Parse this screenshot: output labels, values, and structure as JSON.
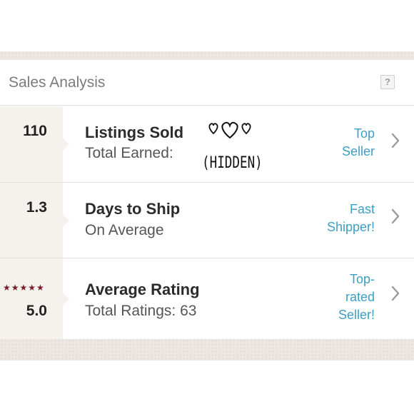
{
  "panel": {
    "title": "Sales Analysis",
    "help_label": "?"
  },
  "rows": [
    {
      "value": "110",
      "label": "Listings Sold",
      "sublabel": "Total Earned:",
      "sublabel_value": "(HIDDEN)",
      "badge": [
        "Top",
        "Seller"
      ]
    },
    {
      "value": "1.3",
      "label": "Days to Ship",
      "sublabel": "On Average",
      "badge": [
        "Fast",
        "Shipper!"
      ]
    },
    {
      "value": "5.0",
      "stars": "★★★★★",
      "label": "Average Rating",
      "sublabel": "Total Ratings: 63",
      "badge": [
        "Top-",
        "rated",
        "Seller!"
      ]
    }
  ],
  "colors": {
    "accent": "#3d9fc3",
    "stars": "#7a1c25",
    "title": "#7b7b7b",
    "left_column": "#f5f2ee"
  },
  "icons": {
    "help": "question-icon",
    "chevron": "chevron-right-icon",
    "hearts": "hand-drawn-hearts-icon"
  }
}
